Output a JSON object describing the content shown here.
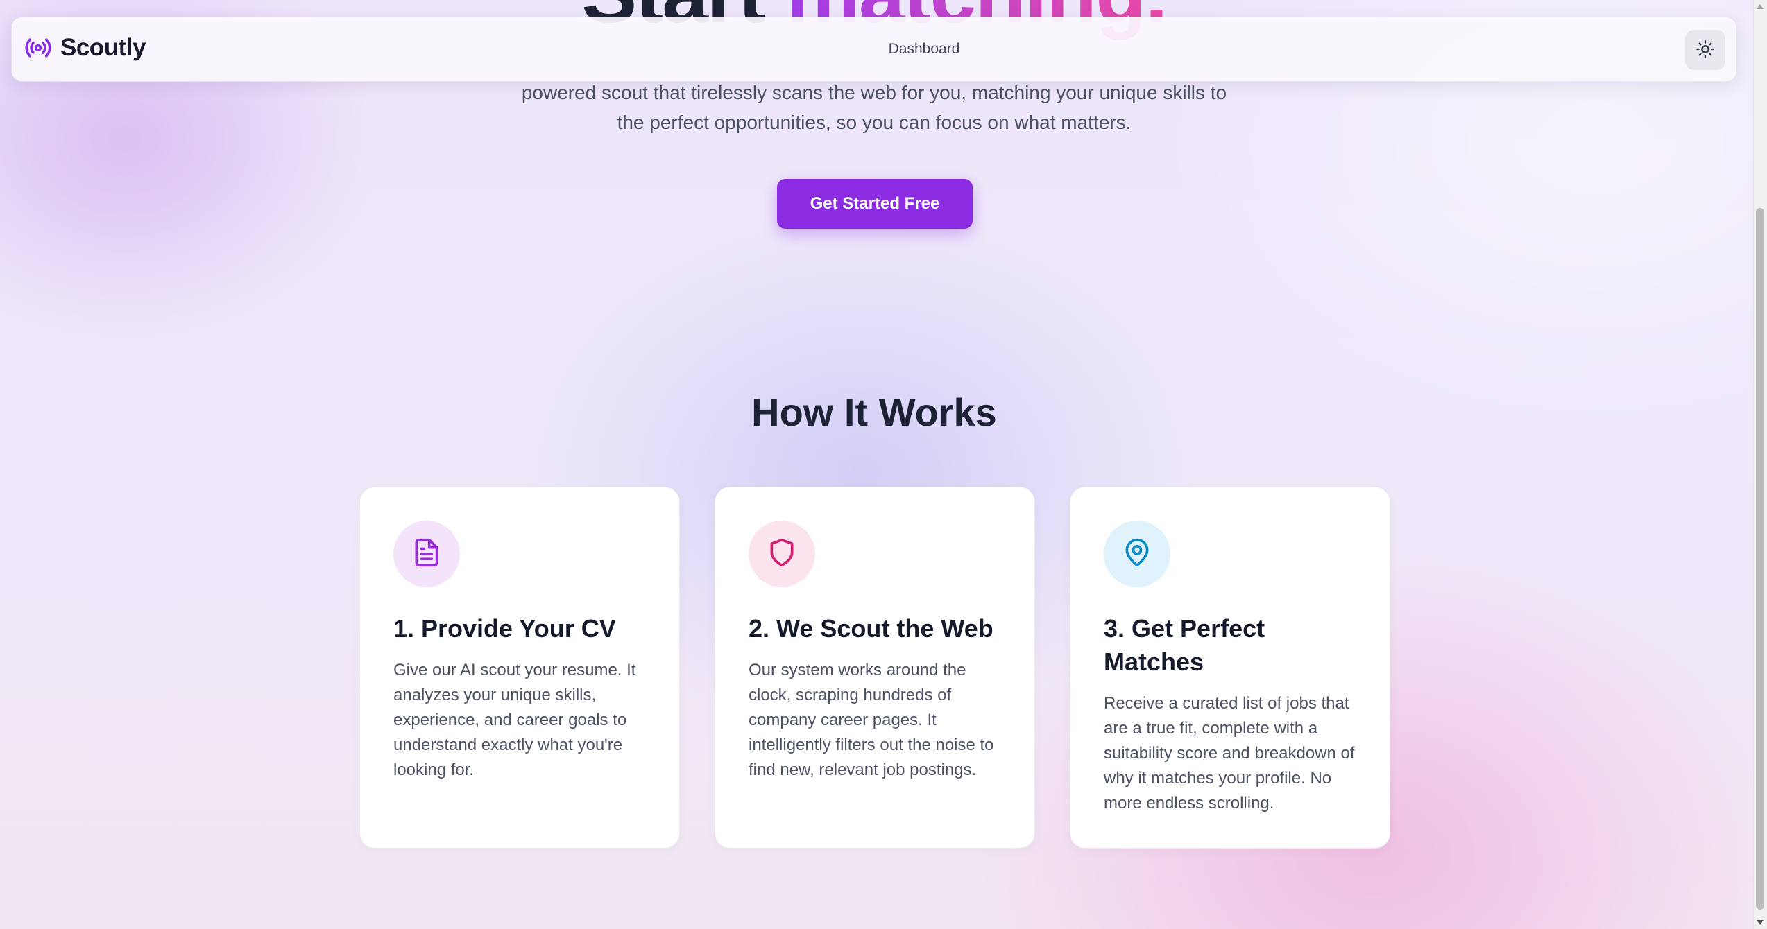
{
  "app": {
    "name": "Scoutly"
  },
  "nav": {
    "links": [
      "Dashboard"
    ],
    "theme_toggle_icon": "sun-icon"
  },
  "hero": {
    "title_plain": "Start ",
    "title_accent": "matching.",
    "subtitle": "powered scout that tirelessly scans the web for you, matching your unique skills to the perfect opportunities, so you can focus on what matters.",
    "cta_label": "Get Started Free"
  },
  "how_it_works": {
    "title": "How It Works",
    "steps": [
      {
        "icon": "document-icon",
        "title": "1. Provide Your CV",
        "description": "Give our AI scout your resume. It analyzes your unique skills, experience, and career goals to understand exactly what you're looking for."
      },
      {
        "icon": "shield-icon",
        "title": "2. We Scout the Web",
        "description": "Our system works around the clock, scraping hundreds of company career pages. It intelligently filters out the noise to find new, relevant job postings."
      },
      {
        "icon": "map-pin-icon",
        "title": "3. Get Perfect Matches",
        "description": "Receive a curated list of jobs that are a true fit, complete with a suitability score and breakdown of why it matches your profile. No more endless scrolling."
      }
    ]
  },
  "colors": {
    "brand_purple": "#8b2be2",
    "accent_pink": "#e94aa4",
    "step1_tint": "#f3e4fc",
    "step2_tint": "#fce4ef",
    "step3_tint": "#e0f2fb"
  }
}
